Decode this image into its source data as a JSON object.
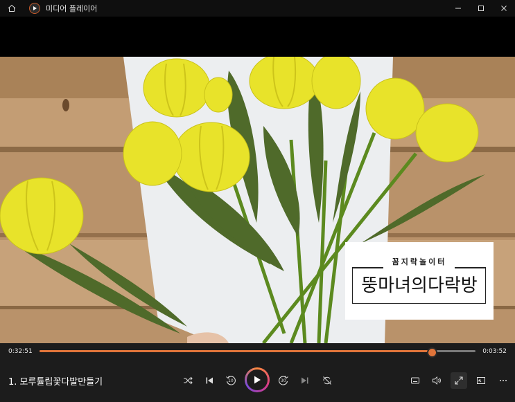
{
  "window": {
    "title": "미디어 플레이어"
  },
  "video": {
    "overlay_logo": {
      "subtitle": "꼼지락놀이터",
      "title": "뚱마녀의다락방"
    }
  },
  "player": {
    "elapsed": "0:32:51",
    "remaining": "0:03:52",
    "progress_fraction": 0.9,
    "track_title": "1. 모루튤립꽃다발만들기",
    "accent_color": "#e0743a",
    "skip_back_seconds": "10",
    "skip_forward_seconds": "30"
  }
}
